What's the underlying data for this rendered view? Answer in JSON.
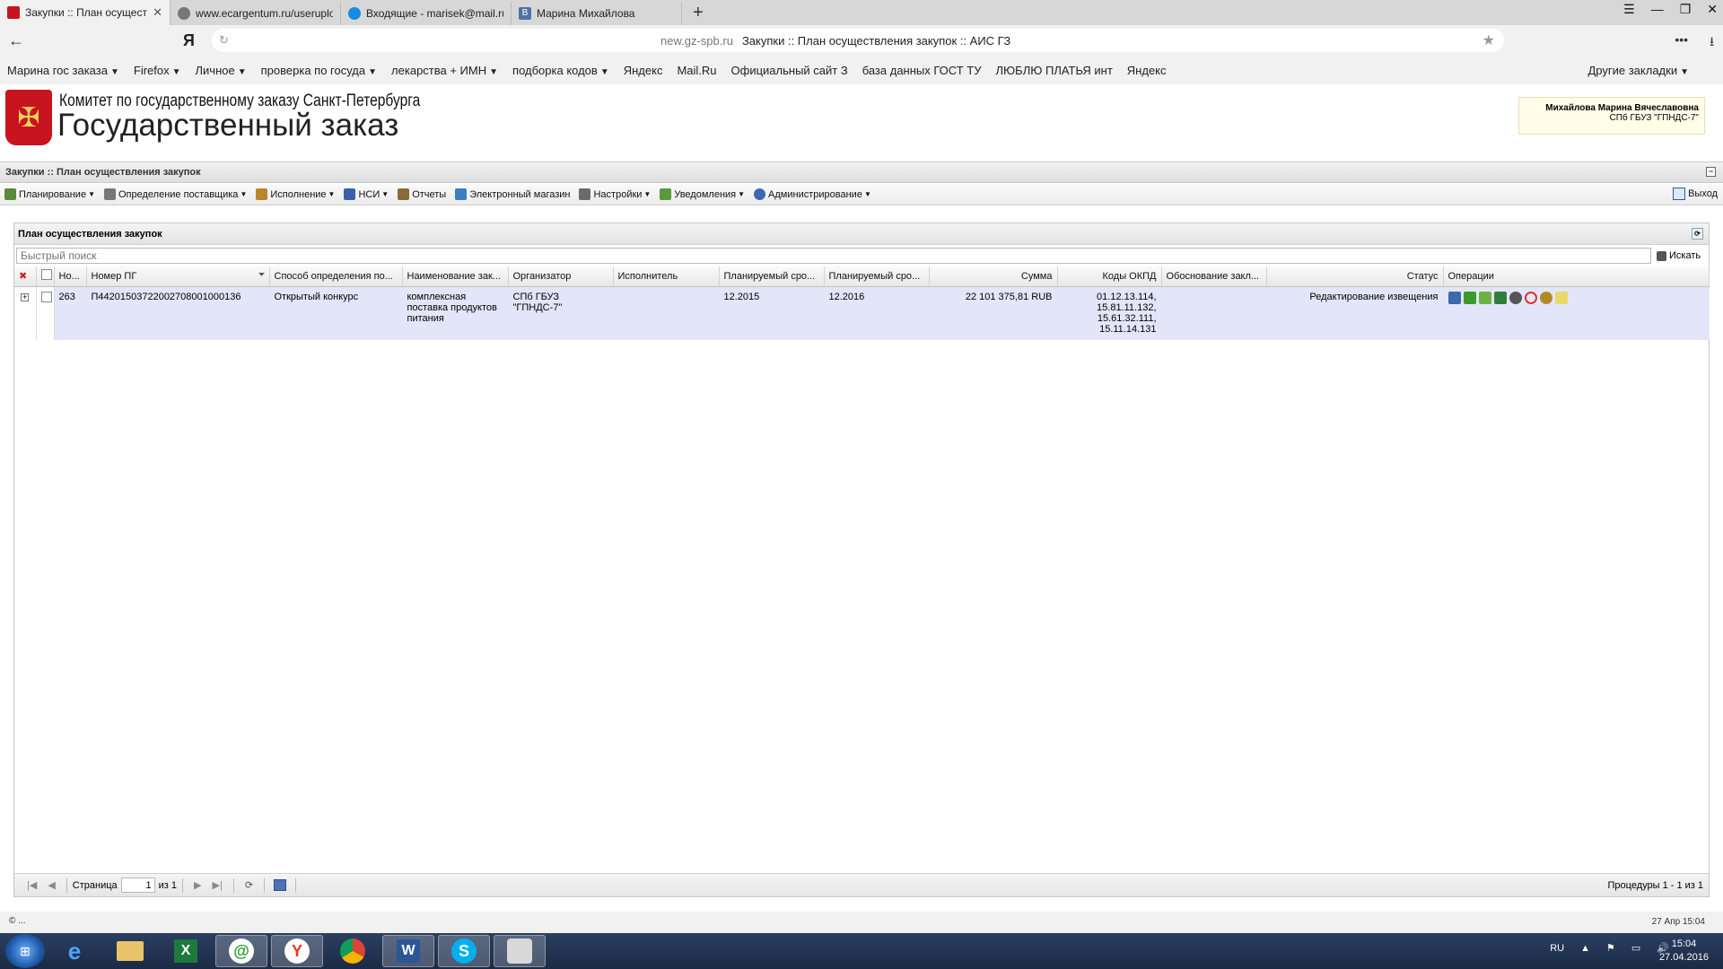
{
  "browser": {
    "tabs": [
      {
        "title": "Закупки :: План осуществления закупок",
        "active": true,
        "favicon_color": "#c8141e"
      },
      {
        "title": "www.ecargentum.ru/userupload",
        "active": false,
        "favicon_color": "#777777"
      },
      {
        "title": "Входящие - marisek@mail.ru",
        "active": false,
        "favicon_color": "#168de2"
      },
      {
        "title": "Марина Михайлова",
        "active": false,
        "favicon_color": "#4c75a3"
      }
    ],
    "yandex_logo": "Я",
    "domain": "new.gz-spb.ru",
    "page_title": "Закупки :: План осуществления закупок :: АИС ГЗ"
  },
  "bookmarks": [
    {
      "label": "Марина гос заказа",
      "dropdown": true
    },
    {
      "label": "Firefox",
      "dropdown": true
    },
    {
      "label": "Личное",
      "dropdown": true
    },
    {
      "label": "проверка по госуда",
      "dropdown": true
    },
    {
      "label": "лекарства + ИМН",
      "dropdown": true
    },
    {
      "label": "подборка кодов",
      "dropdown": true
    },
    {
      "label": "Яндекс",
      "dropdown": false
    },
    {
      "label": "Mail.Ru",
      "dropdown": false
    },
    {
      "label": "Официальный сайт З",
      "dropdown": false
    },
    {
      "label": "база данных ГОСТ ТУ",
      "dropdown": false
    },
    {
      "label": "ЛЮБЛЮ ПЛАТЬЯ инт",
      "dropdown": false
    },
    {
      "label": "Яндекс",
      "dropdown": false
    }
  ],
  "bookmarks_other": "Другие закладки",
  "site": {
    "org_small": "Комитет по государственному заказу Санкт-Петербурга",
    "org_big": "Государственный заказ",
    "user_name": "Михайлова Марина Вячеславовна",
    "user_org": "СПб ГБУЗ \"ГПНДС-7\""
  },
  "breadcrumb": "Закупки :: План осуществления закупок",
  "menu": [
    {
      "label": "Планирование",
      "dropdown": true,
      "icon_color": "#5b8a3a"
    },
    {
      "label": "Определение поставщика",
      "dropdown": true,
      "icon_color": "#777777"
    },
    {
      "label": "Исполнение",
      "dropdown": true,
      "icon_color": "#b8862b"
    },
    {
      "label": "НСИ",
      "dropdown": true,
      "icon_color": "#3a5fa8"
    },
    {
      "label": "Отчеты",
      "dropdown": false,
      "icon_color": "#8a6a3a"
    },
    {
      "label": "Электронный магазин",
      "dropdown": false,
      "icon_color": "#3a7fc1"
    },
    {
      "label": "Настройки",
      "dropdown": true,
      "icon_color": "#6a6a6a"
    },
    {
      "label": "Уведомления",
      "dropdown": true,
      "icon_color": "#5a9a3a"
    },
    {
      "label": "Администрирование",
      "dropdown": true,
      "icon_color": "#3a6ab0"
    }
  ],
  "exit_label": "Выход",
  "panel": {
    "title": "План осуществления закупок",
    "search_placeholder": "Быстрый поиск",
    "search_button": "Искать",
    "columns": [
      "Но...",
      "Номер ПГ",
      "Способ определения по...",
      "Наименование зак...",
      "Организатор",
      "Исполнитель",
      "Планируемый сро...",
      "Планируемый сро...",
      "Сумма",
      "Коды ОКПД",
      "Обоснование закл...",
      "Статус",
      "Операции"
    ],
    "rows": [
      {
        "no": "263",
        "number": "П44201503722002708001000136",
        "method": "Открытый конкурс",
        "name": "комплексная поставка продуктов питания",
        "organizer": "СПб ГБУЗ \"ГПНДС-7\"",
        "executor": "",
        "planned1": "12.2015",
        "planned2": "12.2016",
        "sum": "22 101 375,81 RUB",
        "okpd": "01.12.13.114, 15.81.11.132, 15.61.32.111, 15.11.14.131",
        "justification": "",
        "status": "Редактирование извещения"
      }
    ],
    "operations": [
      "edit-icon",
      "approve-icon",
      "publish-icon",
      "chart-icon",
      "settings-icon",
      "refresh-icon",
      "emblem-icon",
      "sign-icon"
    ]
  },
  "pager": {
    "page_label": "Страница",
    "page_value": "1",
    "of_label": "из 1",
    "info": "Процедуры 1 - 1 из 1"
  },
  "status": {
    "left": "© ...",
    "right": "27 Апр 15:04"
  },
  "taskbar": {
    "lang": "RU",
    "time": "15:04",
    "date": "27.04.2016"
  }
}
